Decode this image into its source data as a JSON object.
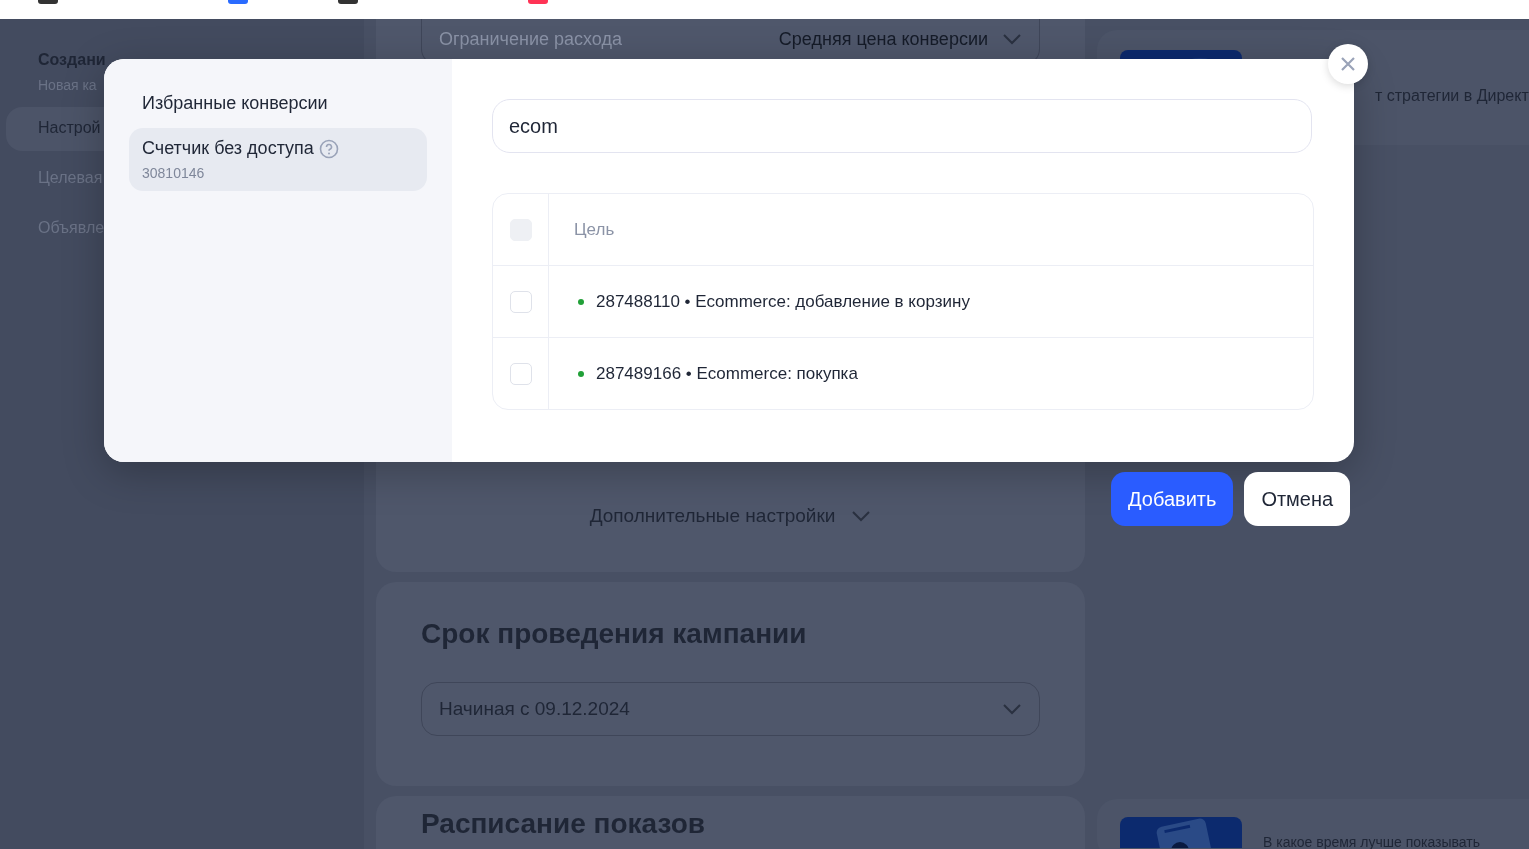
{
  "background_page": {
    "sidebar": {
      "title": "Создани",
      "subtitle": "Новая ка",
      "items": [
        {
          "label": "Настрой",
          "selected": true
        },
        {
          "label": "Целевая",
          "selected": false
        },
        {
          "label": "Объявле",
          "selected": false
        }
      ]
    },
    "strategy_card": {
      "field_label": "Ограничение расхода",
      "field_value": "Средняя цена конверсии",
      "more_settings": "Дополнительные настройки"
    },
    "period_card": {
      "title": "Срок проведения кампании",
      "select_value": "Начиная с 09.12.2024"
    },
    "schedule_card": {
      "title": "Расписание показов"
    },
    "tips": [
      {
        "text": "т стратегии в Директ"
      },
      {
        "text": "В какое время лучше показывать"
      }
    ]
  },
  "dialog": {
    "sidebar": [
      {
        "title": "Избранные конверсии",
        "selected": false
      },
      {
        "title": "Счетчик без доступа",
        "subtitle": "30810146",
        "help": true,
        "selected": true
      }
    ],
    "search": {
      "value": "ecom"
    },
    "table": {
      "header_checkbox": {
        "disabled": true,
        "checked": false
      },
      "column": "Цель",
      "rows": [
        {
          "text": "287488110 • Ecommerce: добавление в корзину",
          "checked": false
        },
        {
          "text": "287489166 • Ecommerce: покупка",
          "checked": false
        }
      ]
    },
    "buttons": [
      {
        "label": "Добавить",
        "kind": "primary"
      },
      {
        "label": "Отмена",
        "kind": "secondary"
      }
    ]
  }
}
